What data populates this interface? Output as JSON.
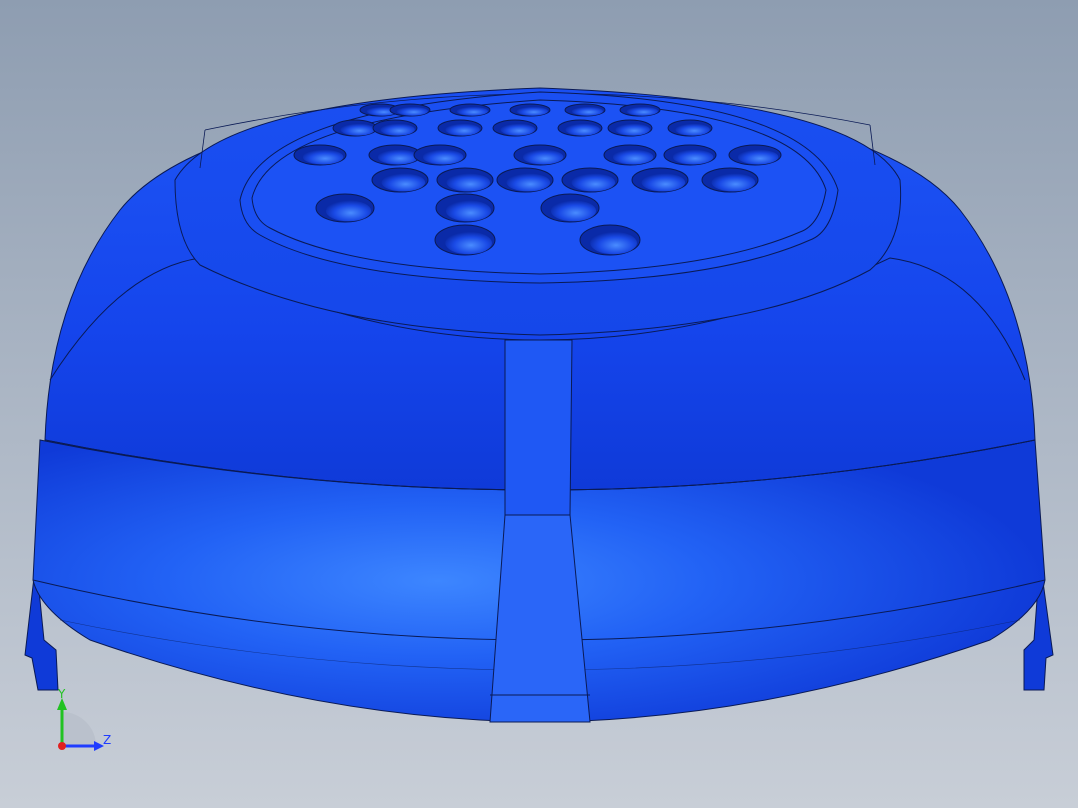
{
  "viewport": {
    "background_top": "#8e9db1",
    "background_bottom": "#c8ced7"
  },
  "model": {
    "part_color": "#1b4ff0",
    "edge_color": "#0a1a55",
    "hole_rows": [
      [
        380,
        410,
        470,
        530,
        585,
        640
      ],
      [
        355,
        395,
        460,
        515,
        580,
        630,
        690
      ],
      [
        320,
        395,
        440,
        540,
        630,
        690,
        755
      ],
      [
        400,
        465,
        525,
        590,
        660,
        730
      ],
      [
        345,
        465,
        570
      ],
      [
        465,
        610
      ]
    ]
  },
  "triad": {
    "y_label": "Y",
    "z_label": "Z",
    "y_color": "#22c222",
    "z_color": "#1f3cff",
    "x_color": "#e02020"
  }
}
